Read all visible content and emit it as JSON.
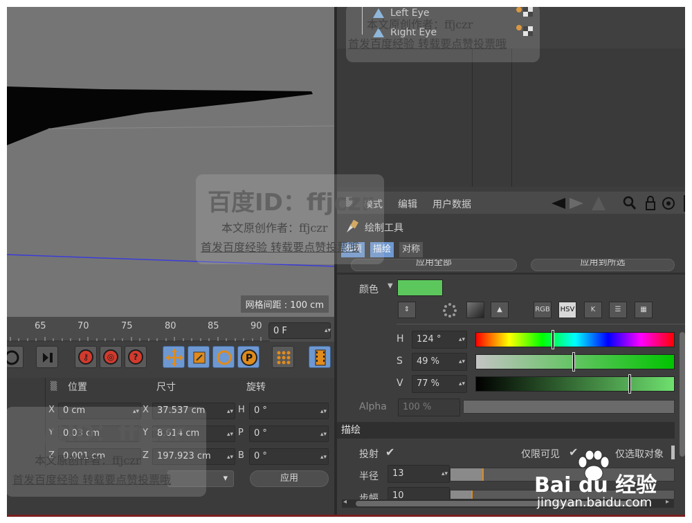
{
  "viewport": {
    "grid_spacing": "网格间距 : 100 cm"
  },
  "timeline": {
    "ticks": [
      "65",
      "70",
      "75",
      "80",
      "85",
      "90"
    ],
    "current_frame": "0 F"
  },
  "coords": {
    "headers": {
      "position": "位置",
      "size": "尺寸",
      "rotation": "旋转"
    },
    "rows": [
      {
        "axis": "X",
        "pos": "0 cm",
        "size_axis": "X",
        "size": "37.537 cm",
        "rot_axis": "H",
        "rot": "0 °"
      },
      {
        "axis": "Y",
        "pos": "0.03 cm",
        "size_axis": "Y",
        "size": "8.614 cm",
        "rot_axis": "P",
        "rot": "0 °"
      },
      {
        "axis": "Z",
        "pos": "0.001 cm",
        "size_axis": "Z",
        "size": "197.923 cm",
        "rot_axis": "B",
        "rot": "0 °"
      }
    ],
    "apply_label": "应用"
  },
  "object_manager": {
    "items": [
      "Left Eye",
      "Right Eye"
    ]
  },
  "attributes": {
    "menu": [
      "模式",
      "编辑",
      "用户数据"
    ],
    "object_name": "绘制工具",
    "tabs": [
      "选项",
      "描绘",
      "对称"
    ],
    "clipped_buttons": [
      "应用全部",
      "应用到所选"
    ],
    "color_label": "颜色",
    "color_value": "#5cc75c",
    "mode_buttons": [
      "RGB",
      "HSV",
      "K"
    ],
    "hsv": [
      {
        "label": "H",
        "value": "124 °",
        "fraction": 0.386
      },
      {
        "label": "S",
        "value": "49 %",
        "fraction": 0.49
      },
      {
        "label": "V",
        "value": "77 %",
        "fraction": 0.77
      }
    ],
    "alpha": {
      "label": "Alpha",
      "value": "100 %"
    },
    "draw_section": "描绘",
    "checkbox_project": "投射",
    "checkbox_visible": "仅限可见",
    "checkbox_selected": "仅选取对象",
    "radius_label": "半径",
    "radius_value": "13",
    "step_label": "步幅",
    "step_value": "10"
  },
  "watermarks": {
    "id_text": "百度ID：ffjczr",
    "author_text": "本文原创作者：ffjczr",
    "notice_text": "首发百度经验 转载要点赞投票哦",
    "baidu_logo": "Bai du 经验",
    "baidu_url": "jingyan.baidu.com"
  },
  "colors": {
    "accent_blue": "#6e98d1",
    "record_red": "#d23a2d"
  }
}
